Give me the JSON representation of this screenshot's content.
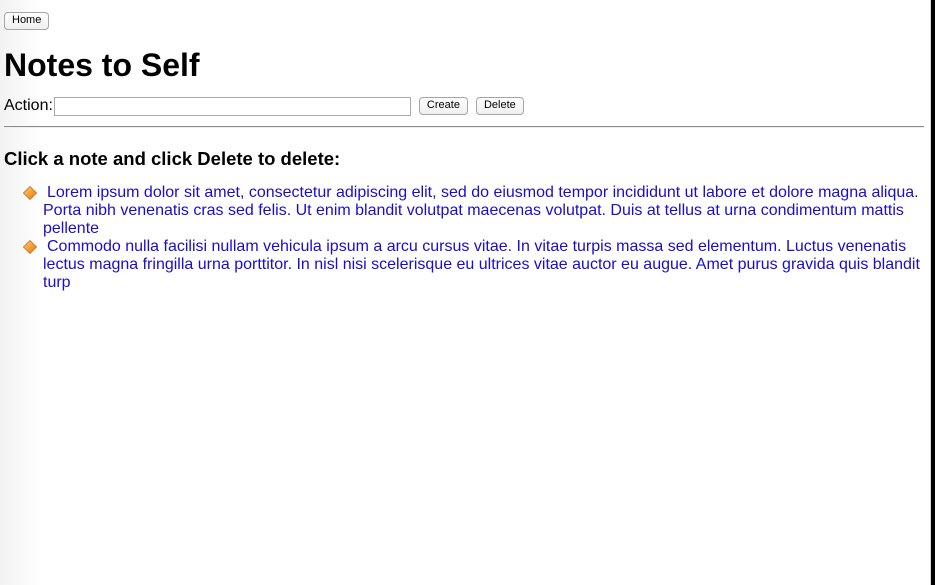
{
  "toolbar": {
    "home_label": "Home"
  },
  "page": {
    "title": "Notes to Self"
  },
  "action": {
    "label": "Action:",
    "input_value": "",
    "create_label": "Create",
    "delete_label": "Delete"
  },
  "instructions": "Click a note and click Delete to delete:",
  "notes": [
    {
      "icon": "orange-diamond-icon",
      "text": "Lorem ipsum dolor sit amet, consectetur adipiscing elit, sed do eiusmod tempor incididunt ut labore et dolore magna aliqua. Porta nibh venenatis cras sed felis. Ut enim blandit volutpat maecenas volutpat. Duis at tellus at urna condimentum mattis pellente"
    },
    {
      "icon": "orange-diamond-icon",
      "text": "Commodo nulla facilisi nullam vehicula ipsum a arcu cursus vitae. In vitae turpis massa sed elementum. Luctus venenatis lectus magna fringilla urna porttitor. In nisl nisi scelerisque eu ultrices vitae auctor eu augue. Amet purus gravida quis blandit turp"
    }
  ],
  "colors": {
    "note_link": "#1a0dcc",
    "icon_orange": "#f5a03a"
  }
}
